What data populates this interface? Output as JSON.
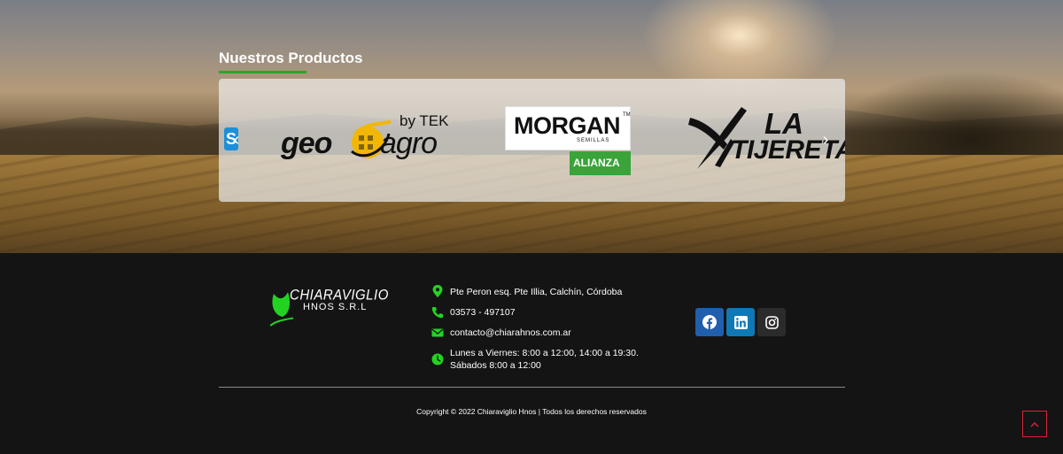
{
  "products": {
    "title": "Nuestros Productos",
    "accent_color": "#2fa32a",
    "carousel": {
      "prev_icon": "chevron-left-icon",
      "next_icon": "chevron-right-icon",
      "edge_logo_letter": "S",
      "logos": [
        {
          "name": "geoagro",
          "geo": "geo",
          "agro": "agro",
          "by": "by TEK"
        },
        {
          "name": "morgan",
          "brand": "MORGAN",
          "tm": "TM",
          "sub": "SEMILLAS",
          "badge": "ALIANZA"
        },
        {
          "name": "tijereta",
          "line1": "LA",
          "line2": "TIJERETA"
        }
      ]
    }
  },
  "footer": {
    "brand": {
      "name": "CHIARAVIGLIO",
      "sub": "HNOS S.R.L"
    },
    "contact": [
      {
        "icon": "map-pin-icon",
        "text": "Pte Peron esq. Pte Illia, Calchín, Córdoba"
      },
      {
        "icon": "phone-icon",
        "text": "03573 - 497107"
      },
      {
        "icon": "envelope-icon",
        "text": "contacto@chiarahnos.com.ar"
      },
      {
        "icon": "clock-icon",
        "text_line1": "Lunes a Viernes: 8:00 a 12:00, 14:00 a 19:30.",
        "text_line2": "Sábados 8:00 a 12:00"
      }
    ],
    "social": [
      {
        "name": "facebook-icon",
        "color": "#1f5fae"
      },
      {
        "name": "linkedin-icon",
        "color": "#0e79b5"
      },
      {
        "name": "instagram-icon",
        "color": "#2b2b2b"
      }
    ],
    "copyright": "Copyright © 2022 Chiaraviglio Hnos | Todos los derechos reservados",
    "icon_color": "#22d322",
    "scroll_top_border": "#d6253a"
  }
}
